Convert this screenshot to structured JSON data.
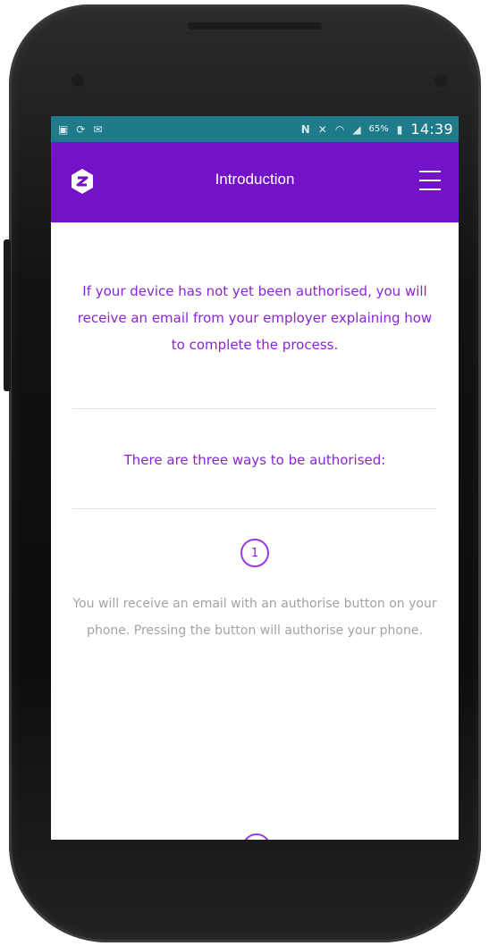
{
  "status_bar": {
    "left_icons": [
      "gallery-icon",
      "sync-icon",
      "message-icon"
    ],
    "right_icons": [
      "nfc-icon",
      "mute-icon",
      "wifi-icon",
      "signal-icon"
    ],
    "battery_percent": "65%",
    "time": "14:39"
  },
  "app_bar": {
    "title": "Introduction",
    "logo_icon": "app-logo-icon",
    "menu_icon": "hamburger-menu-icon"
  },
  "content": {
    "intro_text": "If your device has not yet been authorised, you will receive an email from your employer explaining how to complete the process.",
    "ways_heading": "There are three ways to be authorised:",
    "steps": [
      {
        "number": "1",
        "text": "You will receive an email with an authorise button on your phone. Pressing the button will authorise your phone."
      }
    ]
  },
  "colors": {
    "status_bar": "#1f7b8a",
    "app_bar": "#7312c9",
    "accent_text": "#8b24d6",
    "muted_text": "#a3a3a3"
  }
}
